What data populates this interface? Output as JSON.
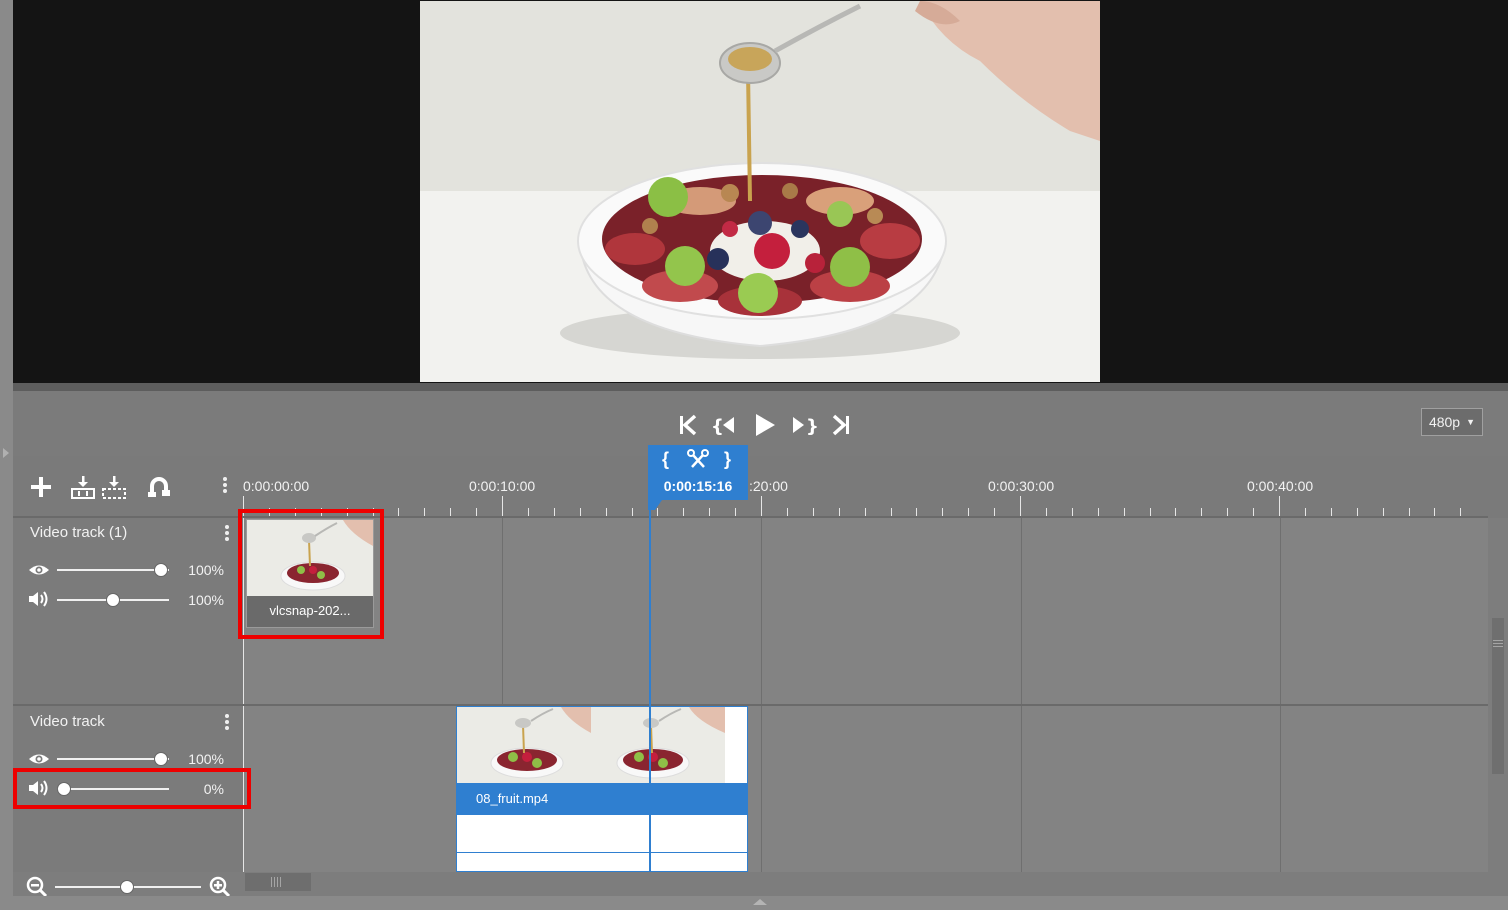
{
  "preview": {
    "resolution": "480p"
  },
  "transport": {
    "buttons": [
      "go-to-start",
      "previous-marker",
      "play",
      "next-marker",
      "go-to-end"
    ]
  },
  "toolbar": {
    "tools": [
      "add",
      "insert-track",
      "insert-track-alt",
      "magnet"
    ]
  },
  "ruler": {
    "labels": [
      "0:00:00:00",
      "0:00:10:00",
      ":20:00",
      "0:00:30:00",
      "0:00:40:00"
    ]
  },
  "playhead": {
    "time": "0:00:15:16",
    "left_brace": "{",
    "right_brace": "}"
  },
  "tracks": [
    {
      "name": "Video track (1)",
      "visibility": "100%",
      "volume": "100%",
      "visibility_level": 1.0,
      "volume_level": 0.5
    },
    {
      "name": "Video track",
      "visibility": "100%",
      "volume": "0%",
      "visibility_level": 1.0,
      "volume_level": 0.0
    }
  ],
  "clips": [
    {
      "name": "vlcsnap-202...",
      "track": 1
    },
    {
      "name": "08_fruit.mp4",
      "track": 2
    }
  ],
  "colors": {
    "accent": "#2f7fd0",
    "highlight": "#ee0000"
  }
}
